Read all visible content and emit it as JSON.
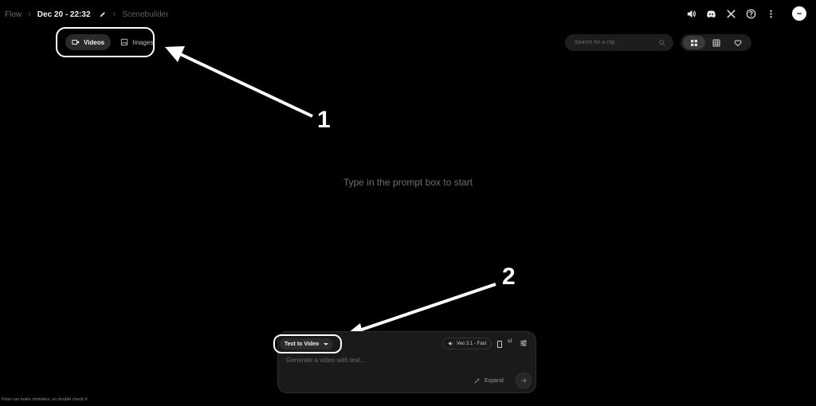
{
  "breadcrumb": {
    "root": "Flow",
    "project": "Dec 20 - 22:32",
    "scene": "Scenebuilder"
  },
  "header_icons": [
    "volume-icon",
    "discord-icon",
    "x-icon",
    "help-icon",
    "more-vert-icon",
    "avatar"
  ],
  "media_tabs": [
    {
      "label": "Videos",
      "icon": "video-icon",
      "active": true
    },
    {
      "label": "Images",
      "icon": "image-icon",
      "active": false
    }
  ],
  "search": {
    "placeholder": "Search for a clip"
  },
  "view_options": [
    {
      "icon": "grid-view-icon",
      "active": true
    },
    {
      "icon": "table-view-icon",
      "active": false
    },
    {
      "icon": "heart-icon",
      "active": false
    }
  ],
  "empty_state": "Type in the prompt box to start",
  "annotations": [
    "1",
    "2"
  ],
  "prompt": {
    "mode": "Text to Video",
    "model": "Veo 3.1 - Fast",
    "count": "x1",
    "placeholder": "Generate a video with text...",
    "expand_label": "Expand"
  },
  "footer_note": "Flow can make mistakes, so double check it",
  "colors": {
    "background": "#000000",
    "panel": "#1a1a1a",
    "annotation": "#ffffff"
  }
}
